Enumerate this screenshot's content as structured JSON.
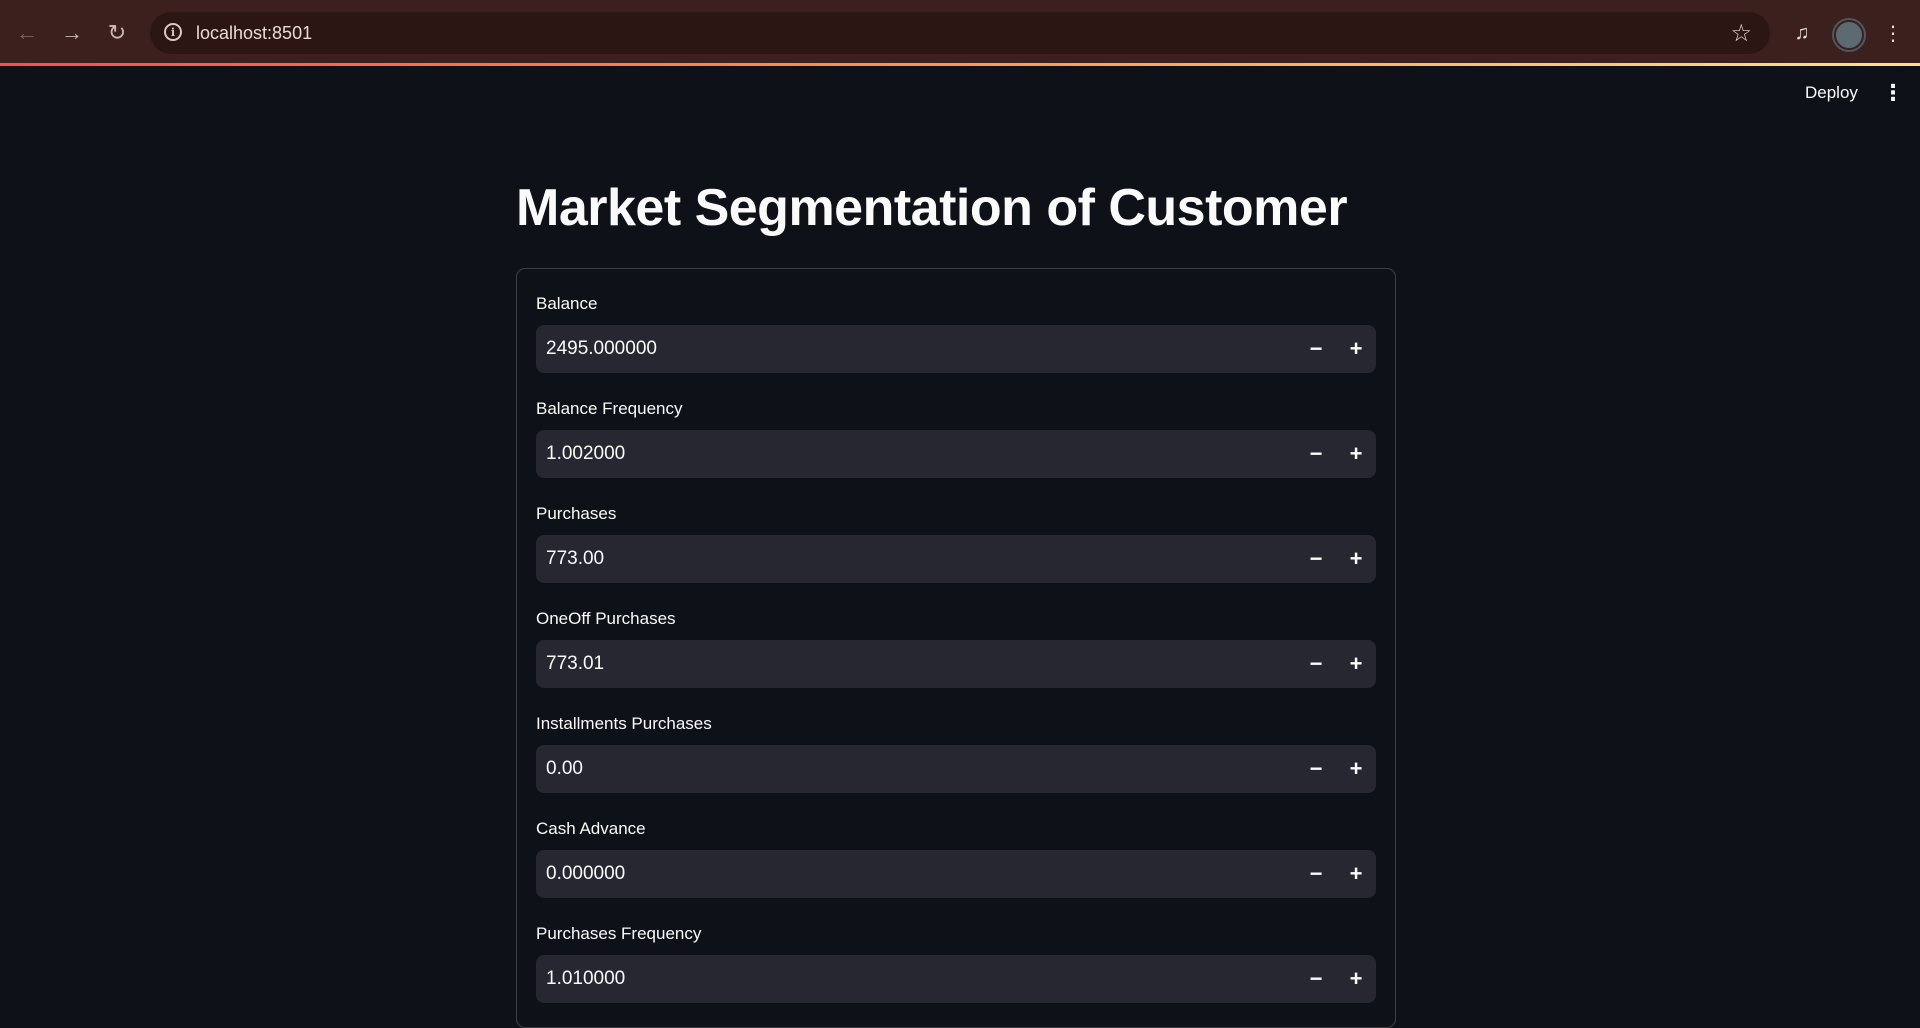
{
  "browser": {
    "url": "localhost:8501",
    "icons": {
      "back": "arrow-left-icon",
      "forward": "arrow-right-icon",
      "reload": "reload-icon",
      "site_info": "info-icon",
      "bookmark": "star-icon",
      "media": "media-queue-icon",
      "profile": "avatar",
      "menu": "kebab-menu-icon"
    }
  },
  "header": {
    "deploy_label": "Deploy"
  },
  "main": {
    "title": "Market Segmentation of Customer",
    "fields": [
      {
        "label": "Balance",
        "value": "2495.000000"
      },
      {
        "label": "Balance Frequency",
        "value": "1.002000"
      },
      {
        "label": "Purchases",
        "value": "773.00"
      },
      {
        "label": "OneOff Purchases",
        "value": "773.01"
      },
      {
        "label": "Installments Purchases",
        "value": "0.00"
      },
      {
        "label": "Cash Advance",
        "value": "0.000000"
      },
      {
        "label": "Purchases Frequency",
        "value": "1.010000"
      }
    ],
    "stepper": {
      "minus": "−",
      "plus": "+"
    }
  },
  "colors": {
    "background": "#0e1117",
    "input_bg": "#262730",
    "text": "#fafafa",
    "chrome_bg": "#3b201e",
    "accent_gradient_start": "#ff4b4b",
    "accent_gradient_end": "#ffe08a"
  }
}
